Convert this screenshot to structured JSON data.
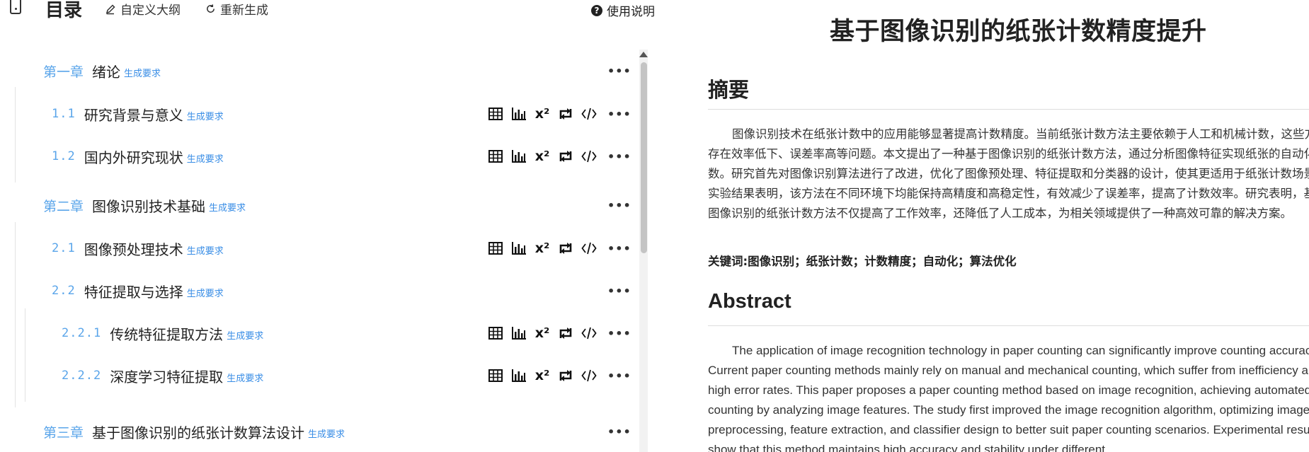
{
  "toolbar": {
    "toc_title": "目录",
    "custom_outline": "自定义大纲",
    "regenerate": "重新生成",
    "help": "使用说明"
  },
  "outline": {
    "req_label": "生成要求",
    "tools": {
      "superscript": "x²"
    },
    "items": [
      {
        "num": "第一章",
        "title": "绪论"
      },
      {
        "num": "1.1",
        "title": "研究背景与意义"
      },
      {
        "num": "1.2",
        "title": "国内外研究现状"
      },
      {
        "num": "第二章",
        "title": "图像识别技术基础"
      },
      {
        "num": "2.1",
        "title": "图像预处理技术"
      },
      {
        "num": "2.2",
        "title": "特征提取与选择"
      },
      {
        "num": "2.2.1",
        "title": "传统特征提取方法"
      },
      {
        "num": "2.2.2",
        "title": "深度学习特征提取"
      },
      {
        "num": "第三章",
        "title": "基于图像识别的纸张计数算法设计"
      }
    ]
  },
  "document": {
    "title": "基于图像识别的纸张计数精度提升",
    "abstract_heading": "摘要",
    "abstract_text": "图像识别技术在纸张计数中的应用能够显著提高计数精度。当前纸张计数方法主要依赖于人工和机械计数，这些方法存在效率低下、误差率高等问题。本文提出了一种基于图像识别的纸张计数方法，通过分析图像特征实现纸张的自动化计数。研究首先对图像识别算法进行了改进，优化了图像预处理、特征提取和分类器的设计，使其更适用于纸张计数场景。实验结果表明，该方法在不同环境下均能保持高精度和高稳定性，有效减少了误差率，提高了计数效率。研究表明，基于图像识别的纸张计数方法不仅提高了工作效率，还降低了人工成本，为相关领域提供了一种高效可靠的解决方案。",
    "keywords": "关键词:图像识别；纸张计数；计数精度；自动化；算法优化",
    "english_heading": "Abstract",
    "english_text": "The application of image recognition technology in paper counting can significantly improve counting accuracy. Current paper counting methods mainly rely on manual and mechanical counting, which suffer from inefficiency and high error rates. This paper proposes a paper counting method based on image recognition, achieving automated counting by analyzing image features. The study first improved the image recognition algorithm, optimizing image preprocessing, feature extraction, and classifier design to better suit paper counting scenarios. Experimental results show that this method maintains high accuracy and stability under different"
  }
}
